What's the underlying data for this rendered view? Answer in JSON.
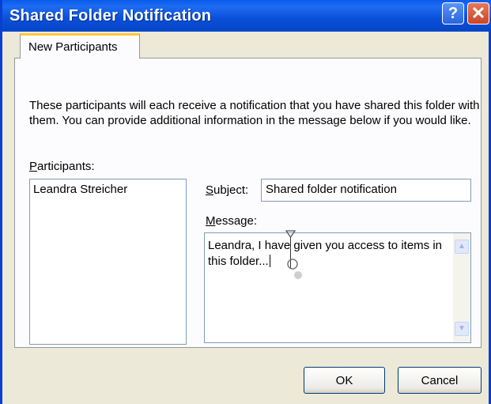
{
  "window": {
    "title": "Shared Folder Notification",
    "help_label": "?",
    "close_label": "✕"
  },
  "tab": {
    "label": "New Participants"
  },
  "intro_text": "These participants will each receive a notification that you have shared this folder with them.  You can provide additional information in the message below if you would like.",
  "participants": {
    "label_access_key": "P",
    "label_rest": "articipants:",
    "items": [
      "Leandra Streicher"
    ]
  },
  "subject": {
    "label_access_key": "S",
    "label_rest": "ubject:",
    "value": "Shared folder notification"
  },
  "message": {
    "label_access_key": "M",
    "label_rest": "essage:",
    "value": "Leandra, I have given you access to items in this folder..."
  },
  "buttons": {
    "ok": "OK",
    "cancel": "Cancel"
  },
  "icons": {
    "scroll_up": "scroll-up-arrow-icon",
    "scroll_down": "scroll-down-arrow-icon",
    "text_cursor": "text-cursor-icon"
  }
}
